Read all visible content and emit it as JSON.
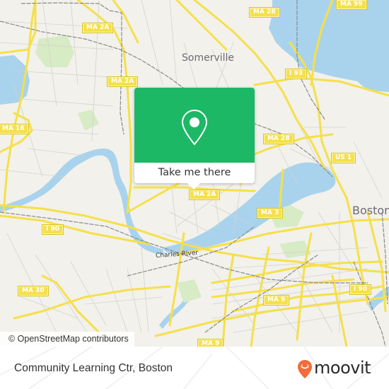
{
  "map": {
    "place_labels": {
      "somerville": "Somerville",
      "boston": "Boston"
    },
    "water_labels": {
      "charles_river": "Charles River"
    },
    "route_shields": [
      {
        "id": "ma-99",
        "label": "MA 99"
      },
      {
        "id": "ma-28-top",
        "label": "MA 28"
      },
      {
        "id": "ma-2a-top",
        "label": "MA 2A"
      },
      {
        "id": "ma-2a-mid",
        "label": "MA 2A"
      },
      {
        "id": "i-93",
        "label": "I 93"
      },
      {
        "id": "ma-16",
        "label": "MA 16"
      },
      {
        "id": "ma-28-mid",
        "label": "MA 28"
      },
      {
        "id": "us-1",
        "label": "US 1"
      },
      {
        "id": "ma-2a-low",
        "label": "MA 2A"
      },
      {
        "id": "ma-3",
        "label": "MA 3"
      },
      {
        "id": "i-90-left",
        "label": "I 90"
      },
      {
        "id": "ma-30",
        "label": "MA 30"
      },
      {
        "id": "ma-9-mid",
        "label": "MA 9"
      },
      {
        "id": "i-90-right",
        "label": "I 90"
      },
      {
        "id": "ma-9-bottom",
        "label": "MA 9"
      }
    ],
    "attribution": "© OpenStreetMap contributors",
    "colors": {
      "land": "#f2f1ec",
      "water": "#a9d3ec",
      "road_major": "#f5e04a",
      "road_minor": "#cfcfcf",
      "rail": "#8a8a8a",
      "park": "#d7ebc4"
    }
  },
  "popup": {
    "icon": "map-pin-icon",
    "cta_label": "Take me there",
    "color": "#1db866"
  },
  "footer": {
    "location_title": "Community Learning Ctr, Boston",
    "brand": {
      "name": "moovit",
      "icon": "moovit-smile-pin-icon",
      "color": "#f26b3a"
    }
  }
}
